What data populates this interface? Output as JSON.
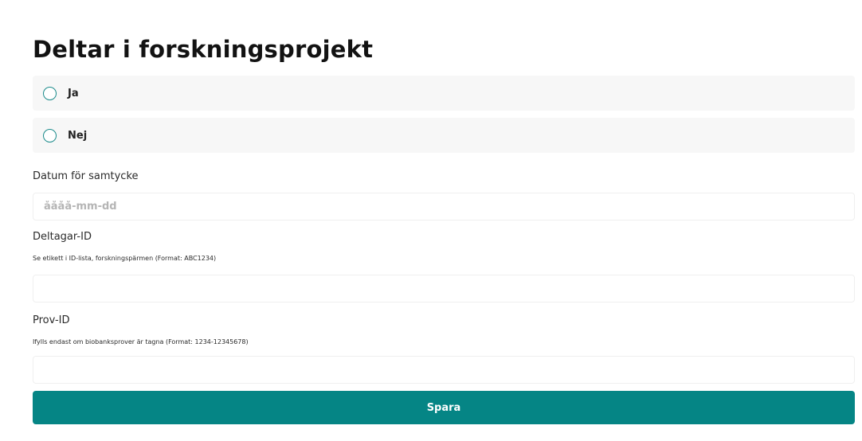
{
  "form": {
    "title": "Deltar i forskningsprojekt",
    "options": [
      {
        "label": "Ja",
        "selected": false
      },
      {
        "label": "Nej",
        "selected": false
      }
    ],
    "consent_date": {
      "label": "Datum för samtycke",
      "placeholder": "åååå-mm-dd",
      "value": ""
    },
    "participant_id": {
      "label": "Deltagar-ID",
      "hint": "Se etikett i ID-lista, forskningspärmen (Format: ABC1234)",
      "value": ""
    },
    "sample_id": {
      "label": "Prov-ID",
      "hint": "Ifylls endast om biobanksprover är tagna (Format: 1234-12345678)",
      "value": ""
    },
    "save_label": "Spara"
  },
  "colors": {
    "accent": "#058585",
    "radio_border": "#1a8a8a",
    "option_background": "#f7f7f7"
  }
}
